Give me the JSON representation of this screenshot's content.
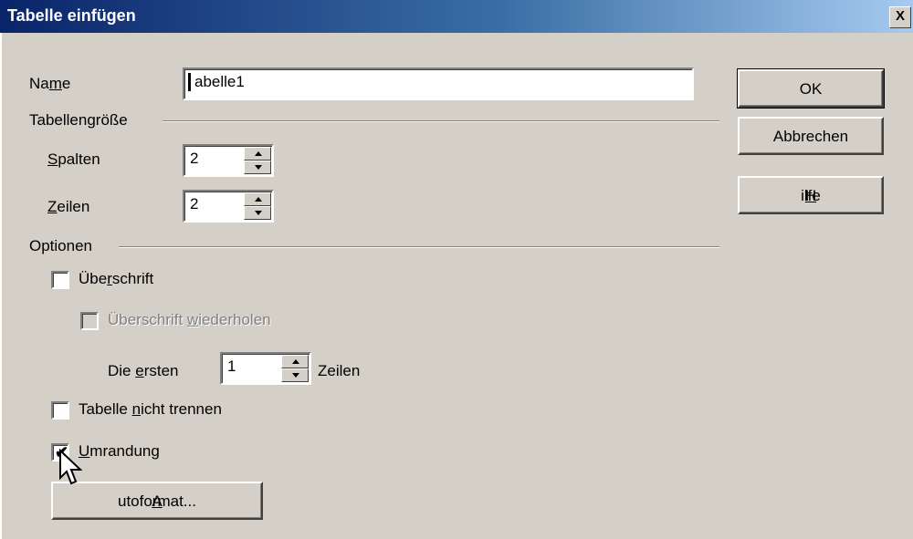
{
  "window": {
    "title": "Tabelle einfügen",
    "close_glyph": "X"
  },
  "name_row": {
    "label_pre": "Na",
    "label_u": "m",
    "label_post": "e",
    "value": "Tabelle1",
    "value_visible": "abelle1"
  },
  "groups": {
    "size": "Tabellengröße",
    "options": "Optionen"
  },
  "columns": {
    "label_u": "S",
    "label_rest": "palten",
    "value": "2"
  },
  "rows": {
    "label_u": "Z",
    "label_rest": "eilen",
    "value": "2"
  },
  "options": {
    "heading": {
      "pre": "Übe",
      "u": "r",
      "post": "schrift",
      "checked": false
    },
    "repeat_heading": {
      "pre": "Überschrift ",
      "u": "w",
      "post": "iederholen",
      "checked": false,
      "enabled": false
    },
    "first_rows": {
      "pre": "Die ",
      "u": "e",
      "post": "rsten",
      "value": "1",
      "suffix": "Zeilen"
    },
    "dont_split": {
      "pre": "Tabelle ",
      "u": "n",
      "post": "icht trennen",
      "checked": false
    },
    "border": {
      "u": "U",
      "post": "mrandung",
      "checked": true
    }
  },
  "buttons": {
    "ok": "OK",
    "cancel": "Abbrechen",
    "help_u": "H",
    "help_rest": "ilfe",
    "autoformat_u": "A",
    "autoformat_rest": "utoformat..."
  },
  "icons": {
    "close": "close-icon",
    "check": "checkmark-icon",
    "cursor": "mouse-pointer-icon"
  }
}
